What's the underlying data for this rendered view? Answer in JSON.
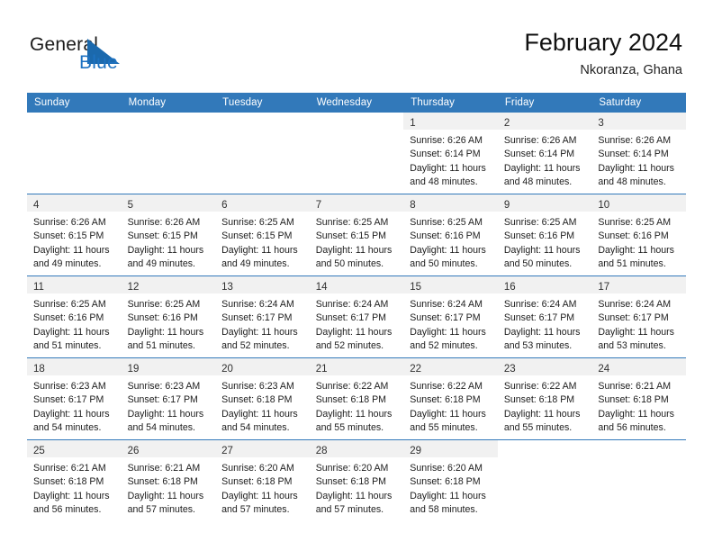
{
  "brand": {
    "name_part1": "General",
    "name_part2": "Blue",
    "mark_icon": "triangle-logo-icon",
    "accent_color": "#1d72c2"
  },
  "header": {
    "title": "February 2024",
    "subtitle": "Nkoranza, Ghana"
  },
  "theme": {
    "header_blue": "#3279ba",
    "daynum_band": "#f1f1f1",
    "text": "#1c1c1c"
  },
  "calendar": {
    "weekday_headers": [
      "Sunday",
      "Monday",
      "Tuesday",
      "Wednesday",
      "Thursday",
      "Friday",
      "Saturday"
    ],
    "weeks": [
      [
        {
          "day": "",
          "lines": []
        },
        {
          "day": "",
          "lines": []
        },
        {
          "day": "",
          "lines": []
        },
        {
          "day": "",
          "lines": []
        },
        {
          "day": "1",
          "lines": [
            "Sunrise: 6:26 AM",
            "Sunset: 6:14 PM",
            "Daylight: 11 hours",
            "and 48 minutes."
          ]
        },
        {
          "day": "2",
          "lines": [
            "Sunrise: 6:26 AM",
            "Sunset: 6:14 PM",
            "Daylight: 11 hours",
            "and 48 minutes."
          ]
        },
        {
          "day": "3",
          "lines": [
            "Sunrise: 6:26 AM",
            "Sunset: 6:14 PM",
            "Daylight: 11 hours",
            "and 48 minutes."
          ]
        }
      ],
      [
        {
          "day": "4",
          "lines": [
            "Sunrise: 6:26 AM",
            "Sunset: 6:15 PM",
            "Daylight: 11 hours",
            "and 49 minutes."
          ]
        },
        {
          "day": "5",
          "lines": [
            "Sunrise: 6:26 AM",
            "Sunset: 6:15 PM",
            "Daylight: 11 hours",
            "and 49 minutes."
          ]
        },
        {
          "day": "6",
          "lines": [
            "Sunrise: 6:25 AM",
            "Sunset: 6:15 PM",
            "Daylight: 11 hours",
            "and 49 minutes."
          ]
        },
        {
          "day": "7",
          "lines": [
            "Sunrise: 6:25 AM",
            "Sunset: 6:15 PM",
            "Daylight: 11 hours",
            "and 50 minutes."
          ]
        },
        {
          "day": "8",
          "lines": [
            "Sunrise: 6:25 AM",
            "Sunset: 6:16 PM",
            "Daylight: 11 hours",
            "and 50 minutes."
          ]
        },
        {
          "day": "9",
          "lines": [
            "Sunrise: 6:25 AM",
            "Sunset: 6:16 PM",
            "Daylight: 11 hours",
            "and 50 minutes."
          ]
        },
        {
          "day": "10",
          "lines": [
            "Sunrise: 6:25 AM",
            "Sunset: 6:16 PM",
            "Daylight: 11 hours",
            "and 51 minutes."
          ]
        }
      ],
      [
        {
          "day": "11",
          "lines": [
            "Sunrise: 6:25 AM",
            "Sunset: 6:16 PM",
            "Daylight: 11 hours",
            "and 51 minutes."
          ]
        },
        {
          "day": "12",
          "lines": [
            "Sunrise: 6:25 AM",
            "Sunset: 6:16 PM",
            "Daylight: 11 hours",
            "and 51 minutes."
          ]
        },
        {
          "day": "13",
          "lines": [
            "Sunrise: 6:24 AM",
            "Sunset: 6:17 PM",
            "Daylight: 11 hours",
            "and 52 minutes."
          ]
        },
        {
          "day": "14",
          "lines": [
            "Sunrise: 6:24 AM",
            "Sunset: 6:17 PM",
            "Daylight: 11 hours",
            "and 52 minutes."
          ]
        },
        {
          "day": "15",
          "lines": [
            "Sunrise: 6:24 AM",
            "Sunset: 6:17 PM",
            "Daylight: 11 hours",
            "and 52 minutes."
          ]
        },
        {
          "day": "16",
          "lines": [
            "Sunrise: 6:24 AM",
            "Sunset: 6:17 PM",
            "Daylight: 11 hours",
            "and 53 minutes."
          ]
        },
        {
          "day": "17",
          "lines": [
            "Sunrise: 6:24 AM",
            "Sunset: 6:17 PM",
            "Daylight: 11 hours",
            "and 53 minutes."
          ]
        }
      ],
      [
        {
          "day": "18",
          "lines": [
            "Sunrise: 6:23 AM",
            "Sunset: 6:17 PM",
            "Daylight: 11 hours",
            "and 54 minutes."
          ]
        },
        {
          "day": "19",
          "lines": [
            "Sunrise: 6:23 AM",
            "Sunset: 6:17 PM",
            "Daylight: 11 hours",
            "and 54 minutes."
          ]
        },
        {
          "day": "20",
          "lines": [
            "Sunrise: 6:23 AM",
            "Sunset: 6:18 PM",
            "Daylight: 11 hours",
            "and 54 minutes."
          ]
        },
        {
          "day": "21",
          "lines": [
            "Sunrise: 6:22 AM",
            "Sunset: 6:18 PM",
            "Daylight: 11 hours",
            "and 55 minutes."
          ]
        },
        {
          "day": "22",
          "lines": [
            "Sunrise: 6:22 AM",
            "Sunset: 6:18 PM",
            "Daylight: 11 hours",
            "and 55 minutes."
          ]
        },
        {
          "day": "23",
          "lines": [
            "Sunrise: 6:22 AM",
            "Sunset: 6:18 PM",
            "Daylight: 11 hours",
            "and 55 minutes."
          ]
        },
        {
          "day": "24",
          "lines": [
            "Sunrise: 6:21 AM",
            "Sunset: 6:18 PM",
            "Daylight: 11 hours",
            "and 56 minutes."
          ]
        }
      ],
      [
        {
          "day": "25",
          "lines": [
            "Sunrise: 6:21 AM",
            "Sunset: 6:18 PM",
            "Daylight: 11 hours",
            "and 56 minutes."
          ]
        },
        {
          "day": "26",
          "lines": [
            "Sunrise: 6:21 AM",
            "Sunset: 6:18 PM",
            "Daylight: 11 hours",
            "and 57 minutes."
          ]
        },
        {
          "day": "27",
          "lines": [
            "Sunrise: 6:20 AM",
            "Sunset: 6:18 PM",
            "Daylight: 11 hours",
            "and 57 minutes."
          ]
        },
        {
          "day": "28",
          "lines": [
            "Sunrise: 6:20 AM",
            "Sunset: 6:18 PM",
            "Daylight: 11 hours",
            "and 57 minutes."
          ]
        },
        {
          "day": "29",
          "lines": [
            "Sunrise: 6:20 AM",
            "Sunset: 6:18 PM",
            "Daylight: 11 hours",
            "and 58 minutes."
          ]
        },
        {
          "day": "",
          "lines": []
        },
        {
          "day": "",
          "lines": []
        }
      ]
    ]
  }
}
